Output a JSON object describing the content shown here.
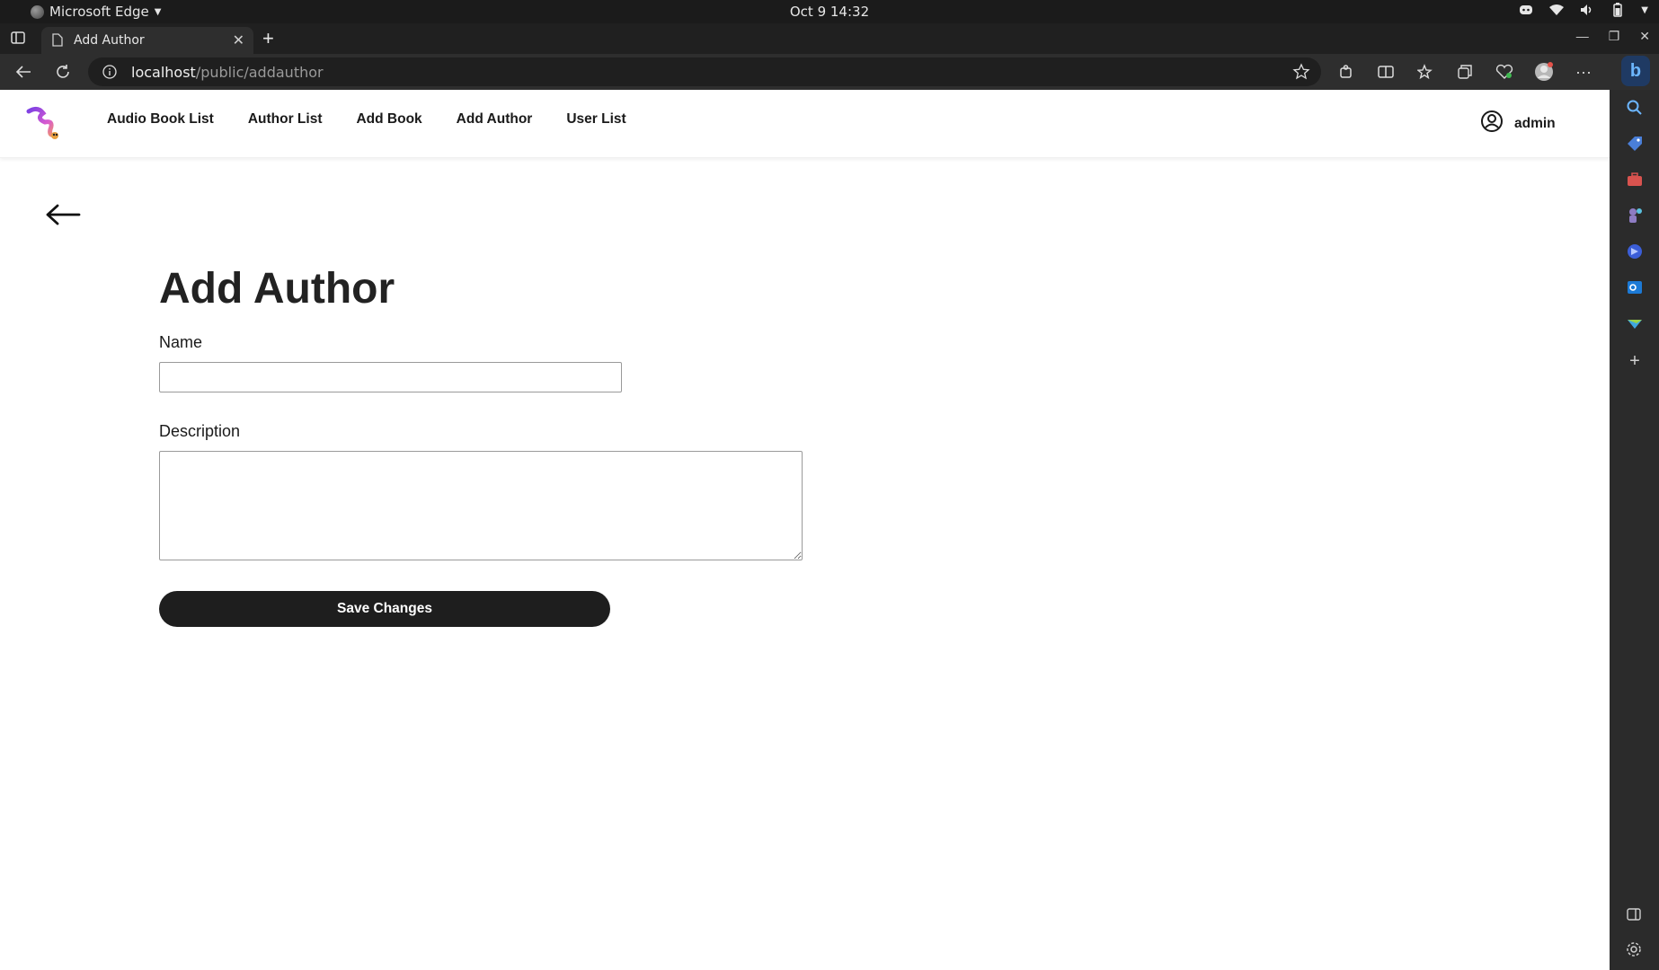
{
  "os": {
    "app_name": "Microsoft Edge",
    "clock": "Oct 9  14:32"
  },
  "browser": {
    "tab_title": "Add Author",
    "url_host": "localhost",
    "url_path": "/public/addauthor"
  },
  "site_nav": {
    "links": [
      "Audio Book List",
      "Author List",
      "Add Book",
      "Add Author",
      "User List"
    ],
    "user_name": "admin"
  },
  "form": {
    "title": "Add Author",
    "name_label": "Name",
    "name_value": "",
    "description_label": "Description",
    "description_value": "",
    "save_label": "Save Changes"
  },
  "colors": {
    "button_bg": "#1e1e1e",
    "os_bar": "#1b1b1b",
    "browser_chrome": "#2e2e2e"
  }
}
